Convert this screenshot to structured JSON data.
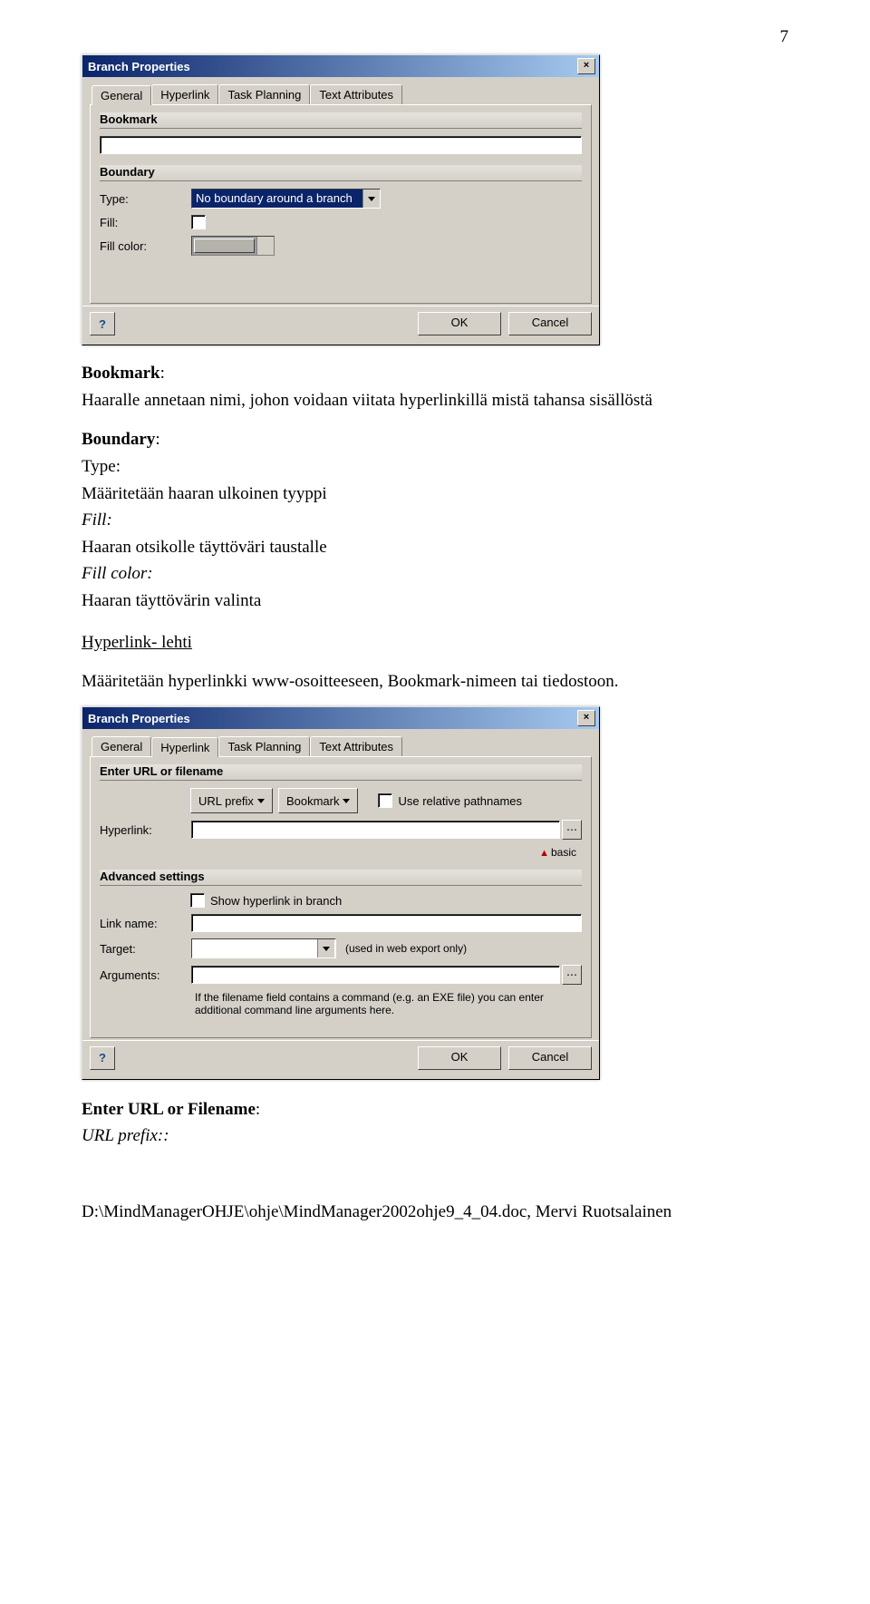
{
  "page_number": "7",
  "dialog1": {
    "title": "Branch Properties",
    "tabs": [
      "General",
      "Hyperlink",
      "Task Planning",
      "Text Attributes"
    ],
    "active_tab": 0,
    "sections": {
      "bookmark": {
        "title": "Bookmark",
        "value": ""
      },
      "boundary": {
        "title": "Boundary",
        "type_label": "Type:",
        "type_value": "No boundary around a branch",
        "fill_label": "Fill:",
        "fill_checked": false,
        "fillcolor_label": "Fill color:"
      }
    },
    "ok": "OK",
    "cancel": "Cancel"
  },
  "text1": {
    "bookmark_h": "Bookmark",
    "bookmark_p": "Haaralle annetaan nimi, johon voidaan viitata hyperlinkillä mistä tahansa sisällöstä",
    "boundary_h": "Boundary",
    "boundary_type": "Type:",
    "boundary_type_desc": "Määritetään haaran ulkoinen tyyppi",
    "fill": "Fill:",
    "fill_desc": "Haaran otsikolle täyttöväri taustalle",
    "fillcolor": "Fill color:",
    "fillcolor_desc": "Haaran täyttövärin valinta",
    "hyperlink_h": "Hyperlink- lehti",
    "hyperlink_p": "Määritetään hyperlinkki www-osoitteeseen, Bookmark-nimeen tai tiedostoon."
  },
  "dialog2": {
    "title": "Branch Properties",
    "tabs": [
      "General",
      "Hyperlink",
      "Task Planning",
      "Text Attributes"
    ],
    "active_tab": 1,
    "enter_section": {
      "title": "Enter URL or filename",
      "url_prefix_btn": "URL prefix",
      "bookmark_btn": "Bookmark",
      "use_relative_label": "Use relative pathnames",
      "hyperlink_label": "Hyperlink:",
      "hyperlink_value": ""
    },
    "basic_label": "basic",
    "advanced_section": {
      "title": "Advanced settings",
      "show_hyperlink_label": "Show hyperlink in branch",
      "linkname_label": "Link name:",
      "linkname_value": "",
      "target_label": "Target:",
      "target_value": "",
      "target_hint": "(used in web export only)",
      "arguments_label": "Arguments:",
      "arguments_value": "",
      "arguments_hint": "If the filename field contains a command (e.g. an EXE file) you can enter additional command line arguments here."
    },
    "ok": "OK",
    "cancel": "Cancel"
  },
  "text2": {
    "enter_h": "Enter URL or Filename",
    "url_prefix": "URL prefix::"
  },
  "footer": "D:\\MindManagerOHJE\\ohje\\MindManager2002ohje9_4_04.doc, Mervi Ruotsalainen"
}
